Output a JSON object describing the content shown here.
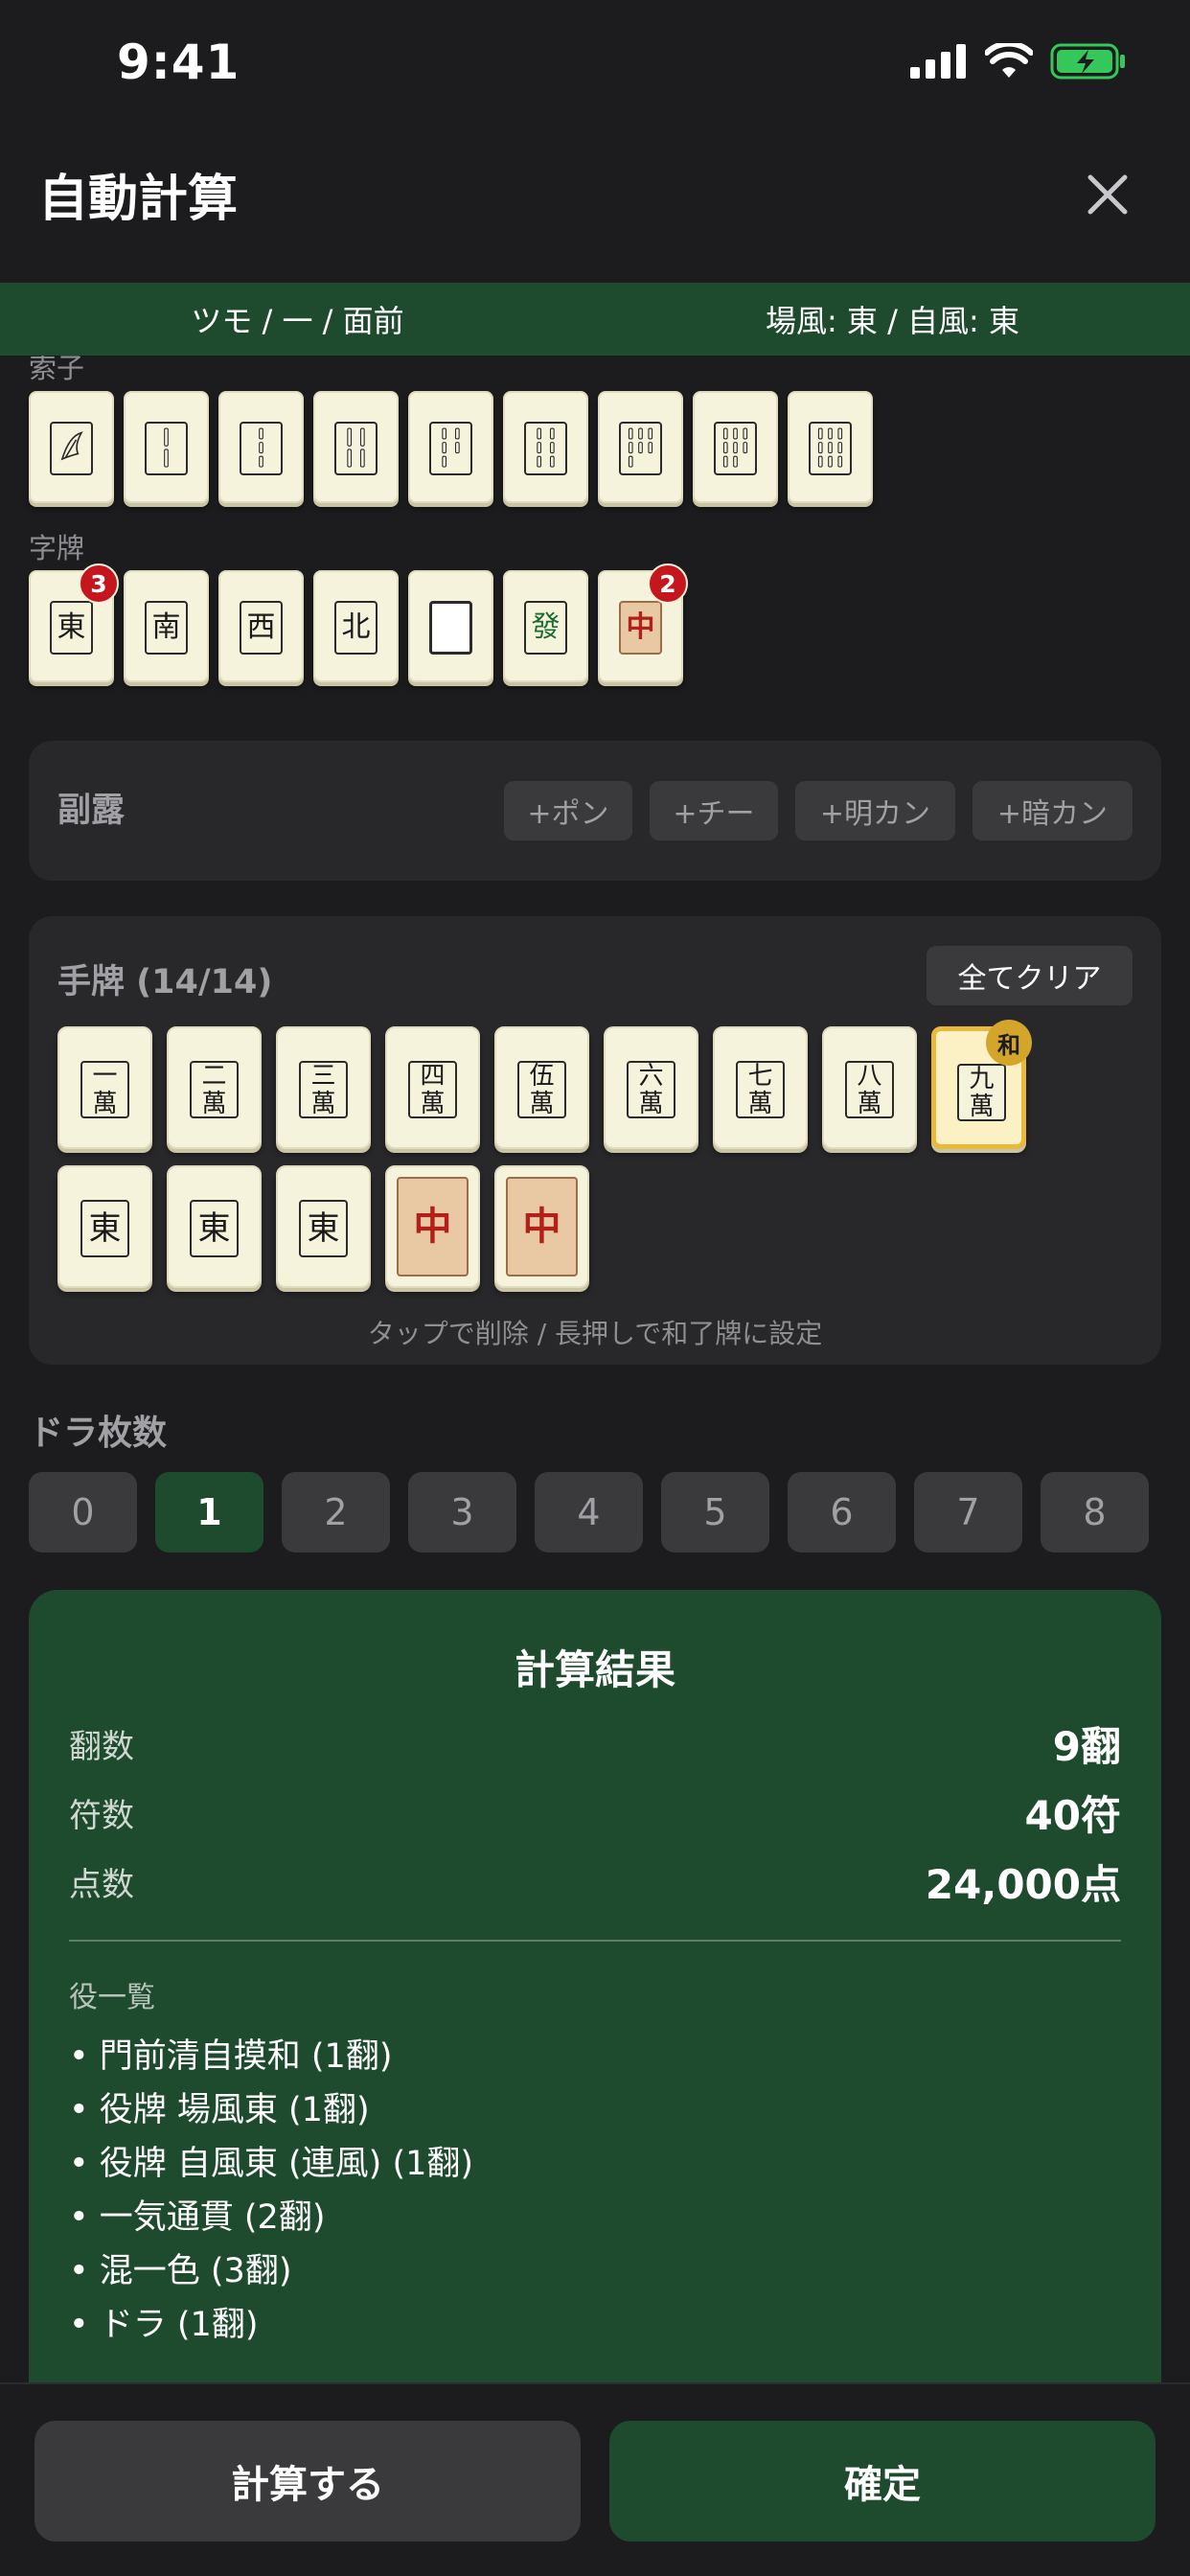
{
  "status_bar": {
    "time": "9:41"
  },
  "header": {
    "title": "自動計算"
  },
  "info_bar": {
    "left": "ツモ / 一 / 面前",
    "right": "場風: 東 / 自風: 東"
  },
  "tile_picker": {
    "sou_label": "索子",
    "honor_label": "字牌",
    "sou_tiles": [
      "1s",
      "2s",
      "3s",
      "4s",
      "5s",
      "6s",
      "7s",
      "8s",
      "9s"
    ],
    "honor_tiles": [
      {
        "glyph": "東",
        "count": "3"
      },
      {
        "glyph": "南",
        "count": ""
      },
      {
        "glyph": "西",
        "count": ""
      },
      {
        "glyph": "北",
        "count": ""
      },
      {
        "glyph": "",
        "count": ""
      },
      {
        "glyph": "發",
        "count": ""
      },
      {
        "glyph": "中",
        "count": "2"
      }
    ]
  },
  "melds": {
    "title": "副露",
    "buttons": [
      "+ポン",
      "+チー",
      "+明カン",
      "+暗カン"
    ]
  },
  "hand": {
    "title": "手牌 (14/14)",
    "clear_label": "全てクリア",
    "row1": [
      {
        "top": "一",
        "bottom": "萬"
      },
      {
        "top": "二",
        "bottom": "萬"
      },
      {
        "top": "三",
        "bottom": "萬"
      },
      {
        "top": "四",
        "bottom": "萬"
      },
      {
        "top": "伍",
        "bottom": "萬"
      },
      {
        "top": "六",
        "bottom": "萬"
      },
      {
        "top": "七",
        "bottom": "萬"
      },
      {
        "top": "八",
        "bottom": "萬"
      },
      {
        "top": "九",
        "bottom": "萬"
      }
    ],
    "row2": [
      "東",
      "東",
      "東",
      "中",
      "中"
    ],
    "win_badge": "和",
    "hint": "タップで削除 / 長押しで和了牌に設定"
  },
  "dora": {
    "title": "ドラ枚数",
    "options": [
      "0",
      "1",
      "2",
      "3",
      "4",
      "5",
      "6",
      "7",
      "8"
    ],
    "selected": "1"
  },
  "result": {
    "title": "計算結果",
    "han_label": "翻数",
    "han_value": "9翻",
    "fu_label": "符数",
    "fu_value": "40符",
    "points_label": "点数",
    "points_value": "24,000点",
    "yaku_header": "役一覧",
    "yaku": [
      "• 門前清自摸和 (1翻)",
      "• 役牌 場風東 (1翻)",
      "• 役牌 自風東 (連風) (1翻)",
      "• 一気通貫 (2翻)",
      "• 混一色 (3翻)",
      "• ドラ (1翻)"
    ]
  },
  "footer": {
    "calculate_label": "計算する",
    "confirm_label": "確定"
  },
  "colors": {
    "accent_green": "#1e4a2e",
    "badge_red": "#c4161c",
    "win_gold": "#d4a52b"
  }
}
